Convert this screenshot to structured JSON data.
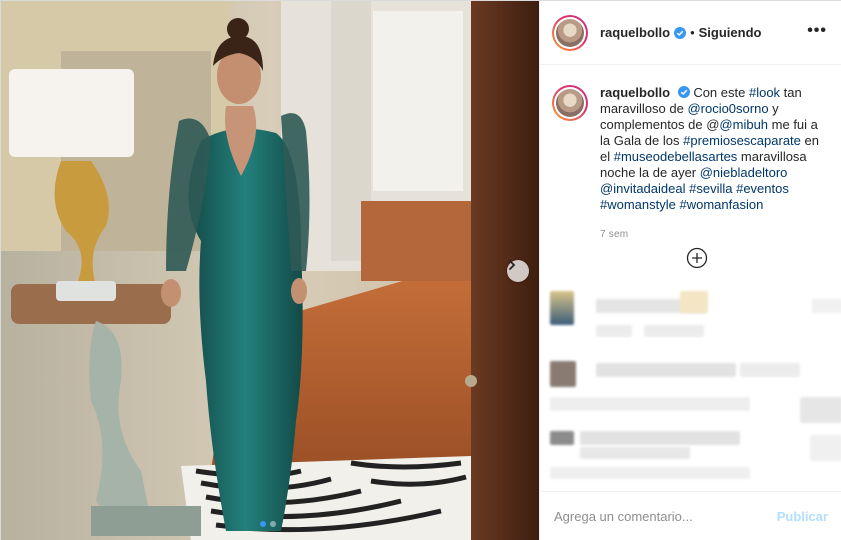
{
  "header": {
    "username": "raquelbollo",
    "separator": "•",
    "follow_status": "Siguiendo",
    "more_label": "•••"
  },
  "caption": {
    "username": "raquelbollo",
    "parts": [
      {
        "t": "Con este ",
        "hl": false
      },
      {
        "t": "#look",
        "hl": true
      },
      {
        "t": " tan maravilloso de ",
        "hl": false
      },
      {
        "t": "@rocio0sorno",
        "hl": true
      },
      {
        "t": " y complementos de @",
        "hl": false
      },
      {
        "t": "@mibuh",
        "hl": true
      },
      {
        "t": " me fui a la Gala de los ",
        "hl": false
      },
      {
        "t": "#premiosescaparate",
        "hl": true
      },
      {
        "t": " en el ",
        "hl": false
      },
      {
        "t": "#museodebellasartes",
        "hl": true
      },
      {
        "t": " maravillosa noche la de ayer ",
        "hl": false
      },
      {
        "t": "@niebladeltoro",
        "hl": true
      },
      {
        "t": " ",
        "hl": false
      },
      {
        "t": "@invitadaideal",
        "hl": true
      },
      {
        "t": " ",
        "hl": false
      },
      {
        "t": "#sevilla",
        "hl": true
      },
      {
        "t": " ",
        "hl": false
      },
      {
        "t": "#eventos",
        "hl": true
      },
      {
        "t": " ",
        "hl": false
      },
      {
        "t": "#womanstyle",
        "hl": true
      },
      {
        "t": " ",
        "hl": false
      },
      {
        "t": "#womanfasion",
        "hl": true
      }
    ],
    "time_ago": "7 sem"
  },
  "carousel": {
    "current_slide": 1,
    "slide_count": 2
  },
  "comment_bar": {
    "placeholder": "Agrega un comentario...",
    "publish_label": "Publicar"
  },
  "colors": {
    "link": "#00376b",
    "verified": "#3897f0",
    "publish_disabled": "#b2dffc",
    "dress": "#1f6d6a"
  },
  "icons": {
    "verified": "verified-badge-icon",
    "more": "more-options-icon",
    "load_more": "plus-circle-icon",
    "next": "chevron-right-icon"
  }
}
